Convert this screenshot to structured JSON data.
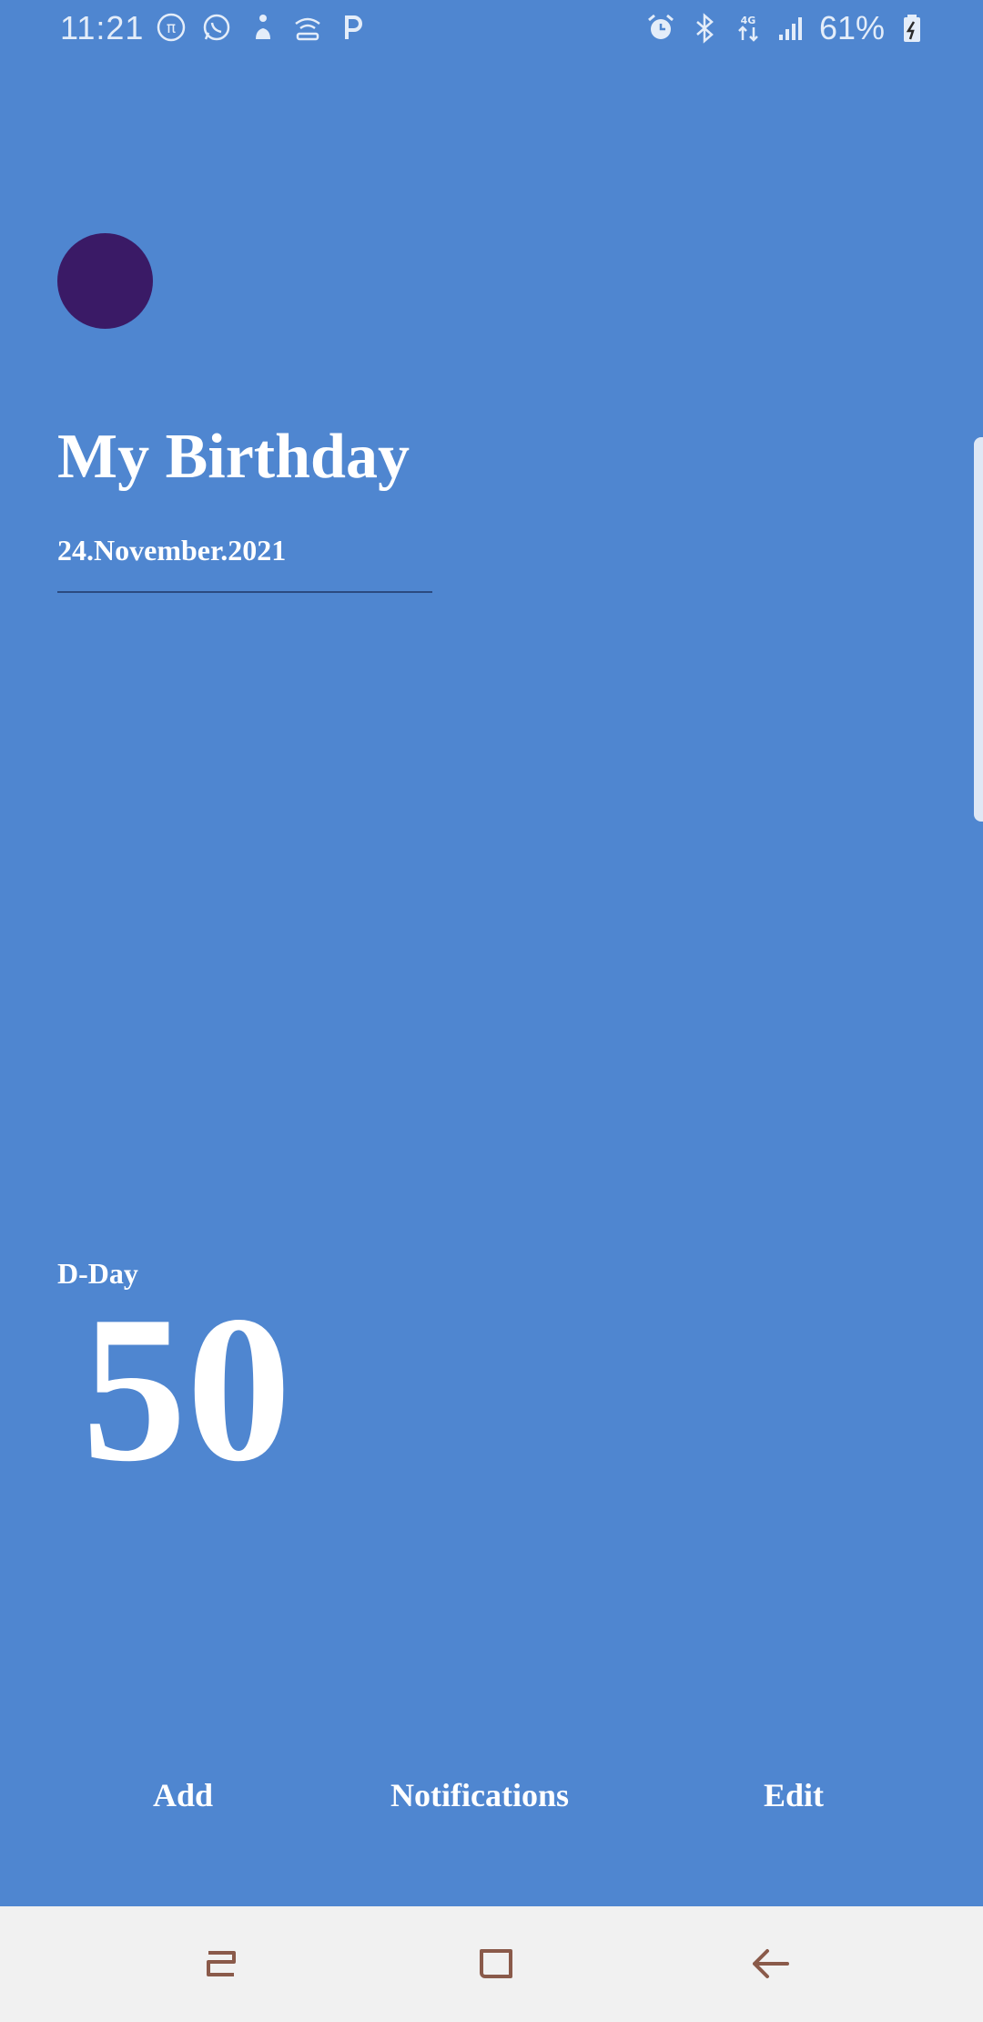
{
  "status_bar": {
    "time": "11:21",
    "battery_percent": "61%",
    "left_icons": [
      "pi-icon",
      "whatsapp-icon",
      "accessibility-icon",
      "hotspot-icon",
      "parking-icon"
    ],
    "right_icons": [
      "alarm-icon",
      "bluetooth-icon",
      "4g-data-icon",
      "signal-icon",
      "battery-icon"
    ]
  },
  "event": {
    "color": "#3a1a66",
    "title": "My Birthday",
    "date": "24.November.2021"
  },
  "counter": {
    "label": "D-Day",
    "value": "50"
  },
  "actions": {
    "add": "Add",
    "notifications": "Notifications",
    "edit": "Edit"
  },
  "theme": {
    "background": "#4f86d0",
    "nav_background": "#f1f1f1",
    "nav_icon_color": "#8a5a4a"
  }
}
